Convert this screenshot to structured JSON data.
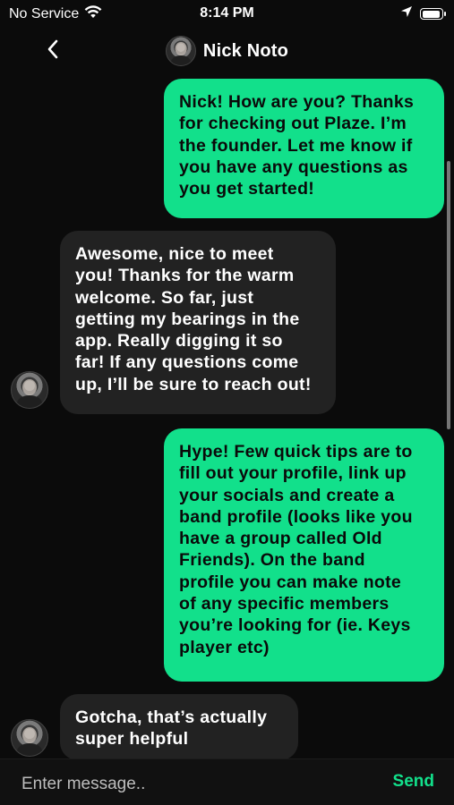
{
  "status_bar": {
    "carrier": "No Service",
    "time": "8:14 PM"
  },
  "header": {
    "contact_name": "Nick Noto"
  },
  "messages": [
    {
      "direction": "outgoing",
      "lines": [
        "Nick! How are you? Thanks",
        "for checking out Plaze. I’m",
        "the founder. Let me know if",
        "you have any questions as",
        "you get started!"
      ]
    },
    {
      "direction": "incoming",
      "lines": [
        "Awesome, nice to meet",
        "you! Thanks for the warm",
        "welcome. So far, just",
        "getting my bearings in the",
        "app. Really digging it so",
        "far! If any questions come",
        "up, I’ll be sure to reach out!"
      ]
    },
    {
      "direction": "outgoing",
      "lines": [
        "Hype! Few quick tips are to",
        "fill out your profile, link up",
        "your socials and create a",
        "band profile (looks like you",
        "have a group called Old",
        "Friends). On the band",
        "profile you can make note",
        "of any specific members",
        "you’re looking for (ie. Keys",
        "player etc)"
      ]
    },
    {
      "direction": "incoming",
      "lines": [
        "Gotcha, that’s actually",
        "super helpful"
      ]
    }
  ],
  "composer": {
    "placeholder": "Enter message..",
    "send_label": "Send"
  },
  "colors": {
    "accent": "#12e08b",
    "incoming_bubble": "#222222",
    "background": "#0b0b0b"
  },
  "icons": {
    "back": "chevron-left-icon",
    "wifi": "wifi-icon",
    "location": "location-arrow-icon",
    "battery": "battery-icon"
  }
}
